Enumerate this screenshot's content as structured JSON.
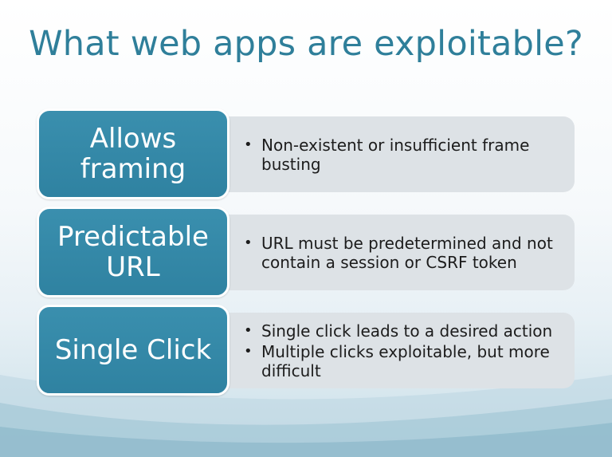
{
  "slide": {
    "title": "What web apps are exploitable?"
  },
  "rows": [
    {
      "label_line1": "Allows",
      "label_line2": "framing",
      "bullets": [
        "Non-existent or insufficient frame busting"
      ]
    },
    {
      "label_line1": "Predictable",
      "label_line2": "URL",
      "bullets": [
        "URL must be predetermined and not contain a session or CSRF token"
      ]
    },
    {
      "label_line1": "Single Click",
      "label_line2": "",
      "bullets": [
        "Single click leads to a desired action",
        "Multiple clicks exploitable, but more difficult"
      ]
    }
  ],
  "colors": {
    "title": "#2f7f9a",
    "box": "#3a8fae",
    "panel": "#dde2e6"
  },
  "bullet_glyph": "•"
}
